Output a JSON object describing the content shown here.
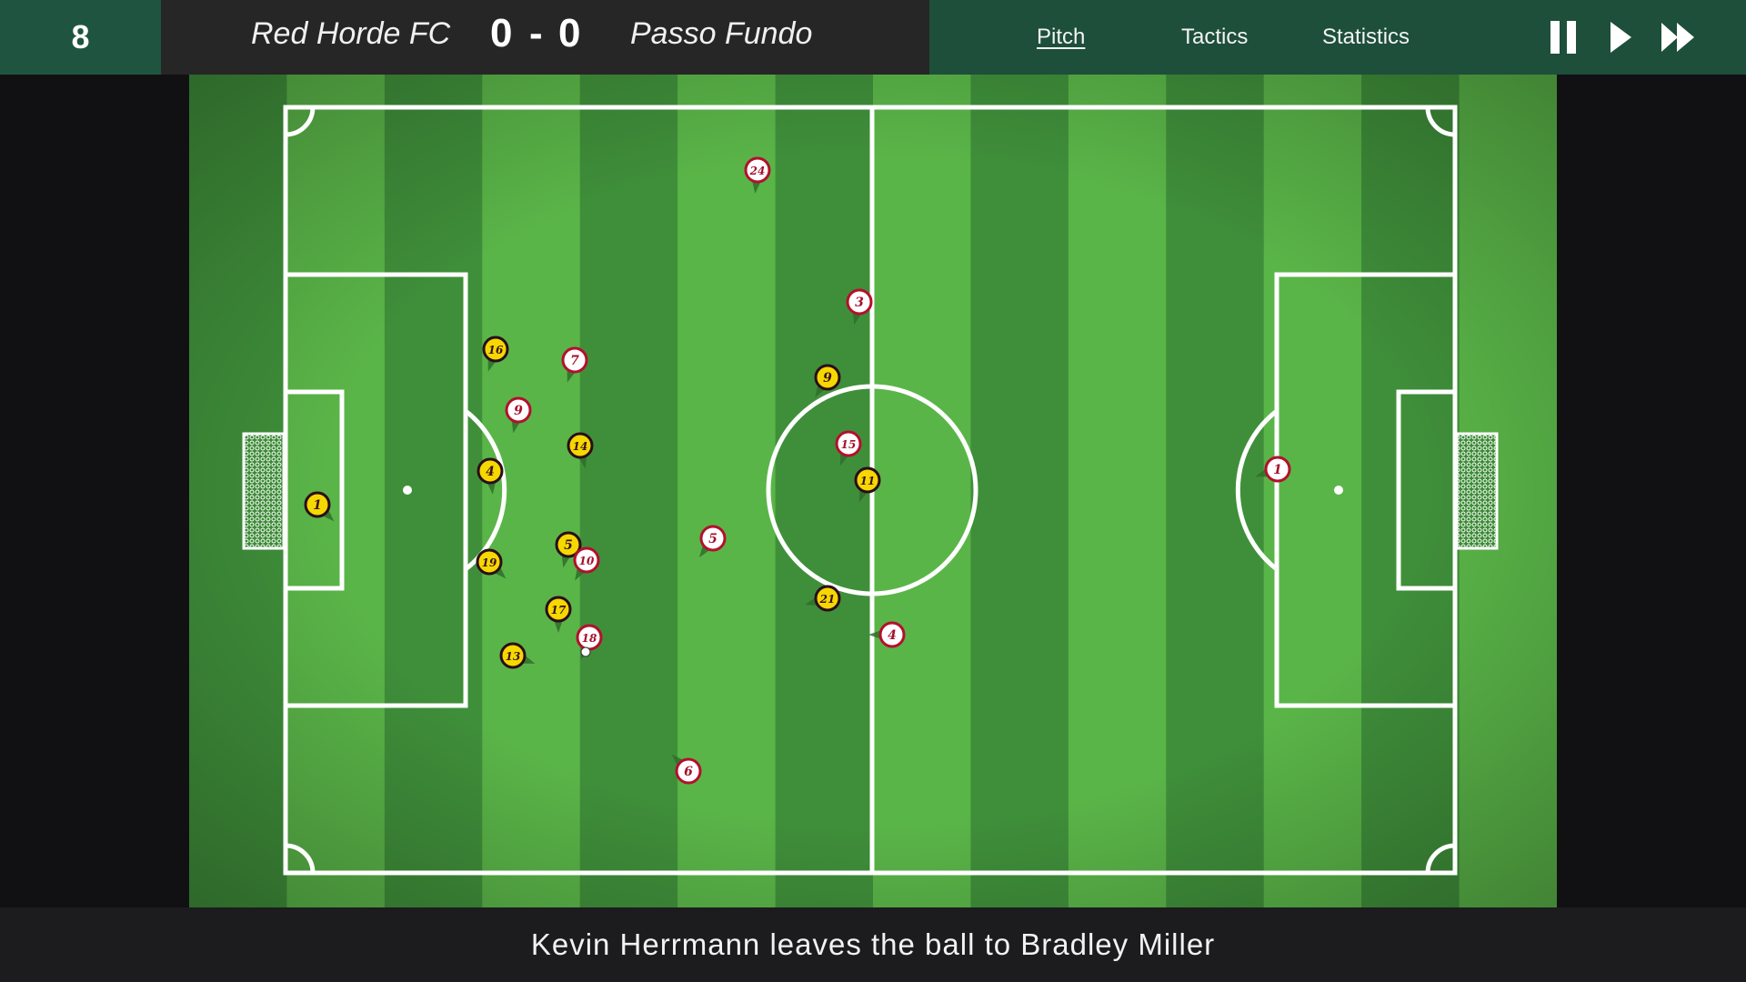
{
  "match": {
    "minute": "8",
    "home_team": "Red Horde FC",
    "away_team": "Passo Fundo",
    "home_score": "0",
    "separator": "-",
    "away_score": "0"
  },
  "nav": {
    "tabs": [
      {
        "label": "Pitch",
        "active": true
      },
      {
        "label": "Tactics",
        "active": false
      },
      {
        "label": "Statistics",
        "active": false
      }
    ]
  },
  "controls": {
    "icons": [
      "pause-icon",
      "play-icon",
      "fast-forward-icon"
    ]
  },
  "colors": {
    "header_green": "#1d4f3a",
    "score_bg": "#262626",
    "pitch_light": "#5ab548",
    "pitch_dark": "#3f8f3a",
    "yellow_team_fill": "#f5d800",
    "yellow_team_ring": "#2a0d1c",
    "white_team_fill": "#ffffff",
    "white_team_ring": "#b3102d"
  },
  "players": [
    {
      "team": "yellow",
      "number": "1"
    },
    {
      "team": "yellow",
      "number": "16"
    },
    {
      "team": "yellow",
      "number": "4"
    },
    {
      "team": "yellow",
      "number": "19"
    },
    {
      "team": "yellow",
      "number": "14"
    },
    {
      "team": "yellow",
      "number": "5"
    },
    {
      "team": "yellow",
      "number": "17"
    },
    {
      "team": "yellow",
      "number": "13"
    },
    {
      "team": "yellow",
      "number": "9"
    },
    {
      "team": "yellow",
      "number": "11"
    },
    {
      "team": "yellow",
      "number": "21"
    },
    {
      "team": "white",
      "number": "24"
    },
    {
      "team": "white",
      "number": "3"
    },
    {
      "team": "white",
      "number": "7"
    },
    {
      "team": "white",
      "number": "9"
    },
    {
      "team": "white",
      "number": "15"
    },
    {
      "team": "white",
      "number": "10"
    },
    {
      "team": "white",
      "number": "5"
    },
    {
      "team": "white",
      "number": "18"
    },
    {
      "team": "white",
      "number": "4"
    },
    {
      "team": "white",
      "number": "6"
    },
    {
      "team": "white",
      "number": "1"
    }
  ],
  "commentary": "Kevin Herrmann leaves the ball to Bradley Miller"
}
